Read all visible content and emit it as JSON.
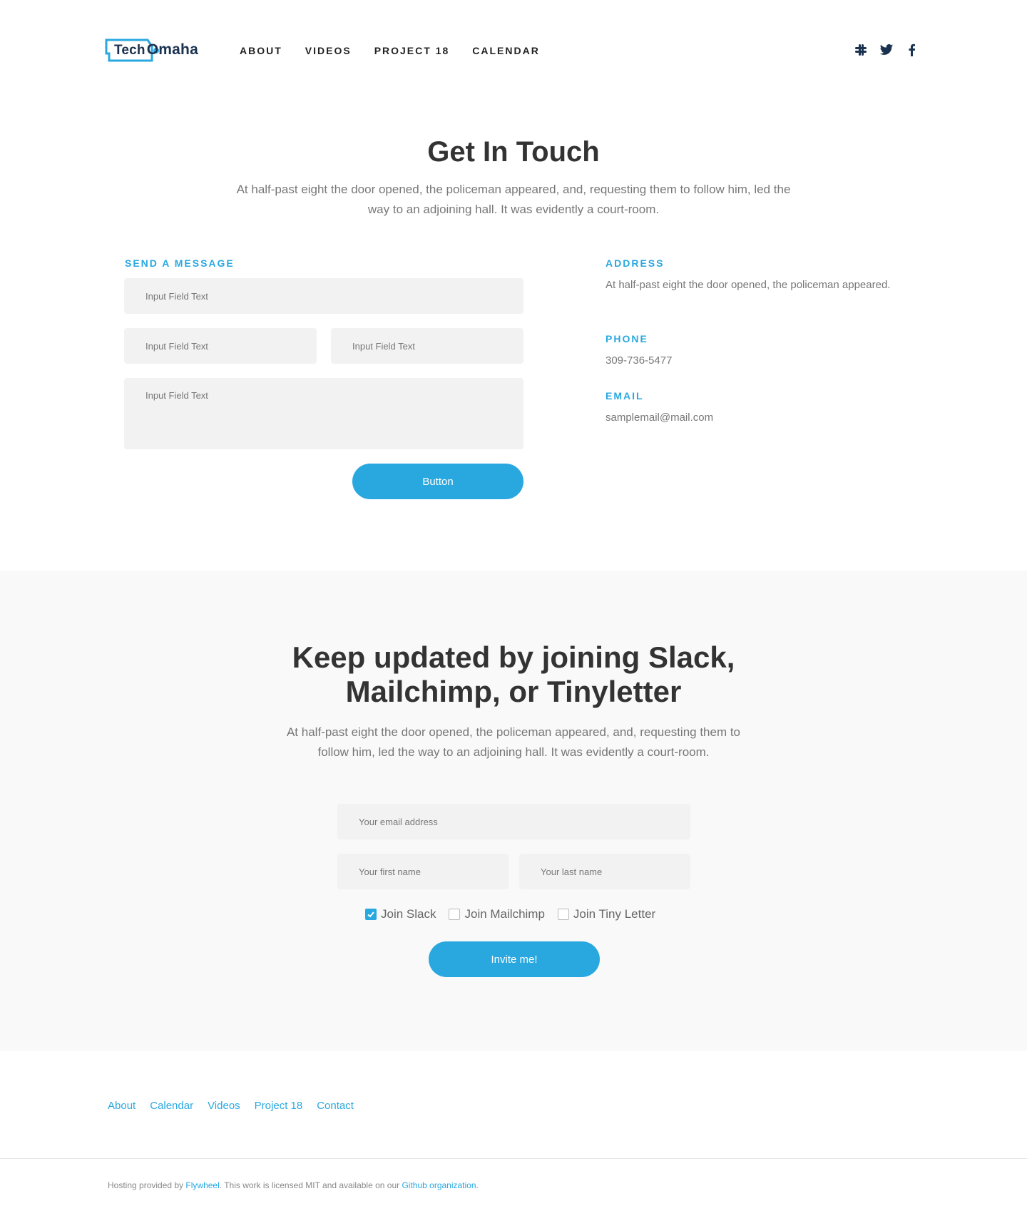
{
  "header": {
    "logo": {
      "part1": "Tech",
      "part2": "Omaha"
    },
    "nav": [
      "About",
      "Videos",
      "Project 18",
      "Calendar"
    ],
    "social_icons": [
      "slack-icon",
      "twitter-icon",
      "facebook-icon"
    ]
  },
  "contact": {
    "title": "Get In Touch",
    "lead": "At half-past eight the door opened, the policeman appeared, and, requesting them to follow him, led the way to an adjoining hall. It was evidently a court-room.",
    "form_label": "Send a Message",
    "fields": {
      "field1_placeholder": "Input Field Text",
      "field2_placeholder": "Input Field Text",
      "field3_placeholder": "Input Field Text",
      "message_placeholder": "Input Field Text"
    },
    "button": "Button",
    "address_label": "Address",
    "address": "At half-past eight the door opened, the policeman appeared.",
    "phone_label": "Phone",
    "phone": "309-736-5477",
    "email_label": "Email",
    "email": "samplemail@mail.com"
  },
  "newsletter": {
    "title_line1": "Keep updated by joining Slack,",
    "title_line2": "Mailchimp, or Tinyletter",
    "lead": "At half-past eight the door opened, the policeman appeared, and, requesting them to follow him, led the way to an adjoining hall. It was evidently a court-room.",
    "email_placeholder": "Your email address",
    "first_name_placeholder": "Your first name",
    "last_name_placeholder": "Your last name",
    "options": [
      {
        "label": "Join Slack",
        "checked": true
      },
      {
        "label": "Join Mailchimp",
        "checked": false
      },
      {
        "label": "Join Tiny Letter",
        "checked": false
      }
    ],
    "button": "Invite me!"
  },
  "footer": {
    "links": [
      "About",
      "Calendar",
      "Videos",
      "Project 18",
      "Contact"
    ],
    "legal": {
      "prefix": "Hosting provided by ",
      "link1": "Flywheel",
      "middle": ". This work is licensed MIT and available on our ",
      "link2": "Github organization",
      "suffix": "."
    }
  },
  "colors": {
    "accent": "#29a8e0",
    "brand_dark": "#1a3150",
    "band_bg": "#f9f9f9",
    "field_bg": "#f2f2f2"
  }
}
